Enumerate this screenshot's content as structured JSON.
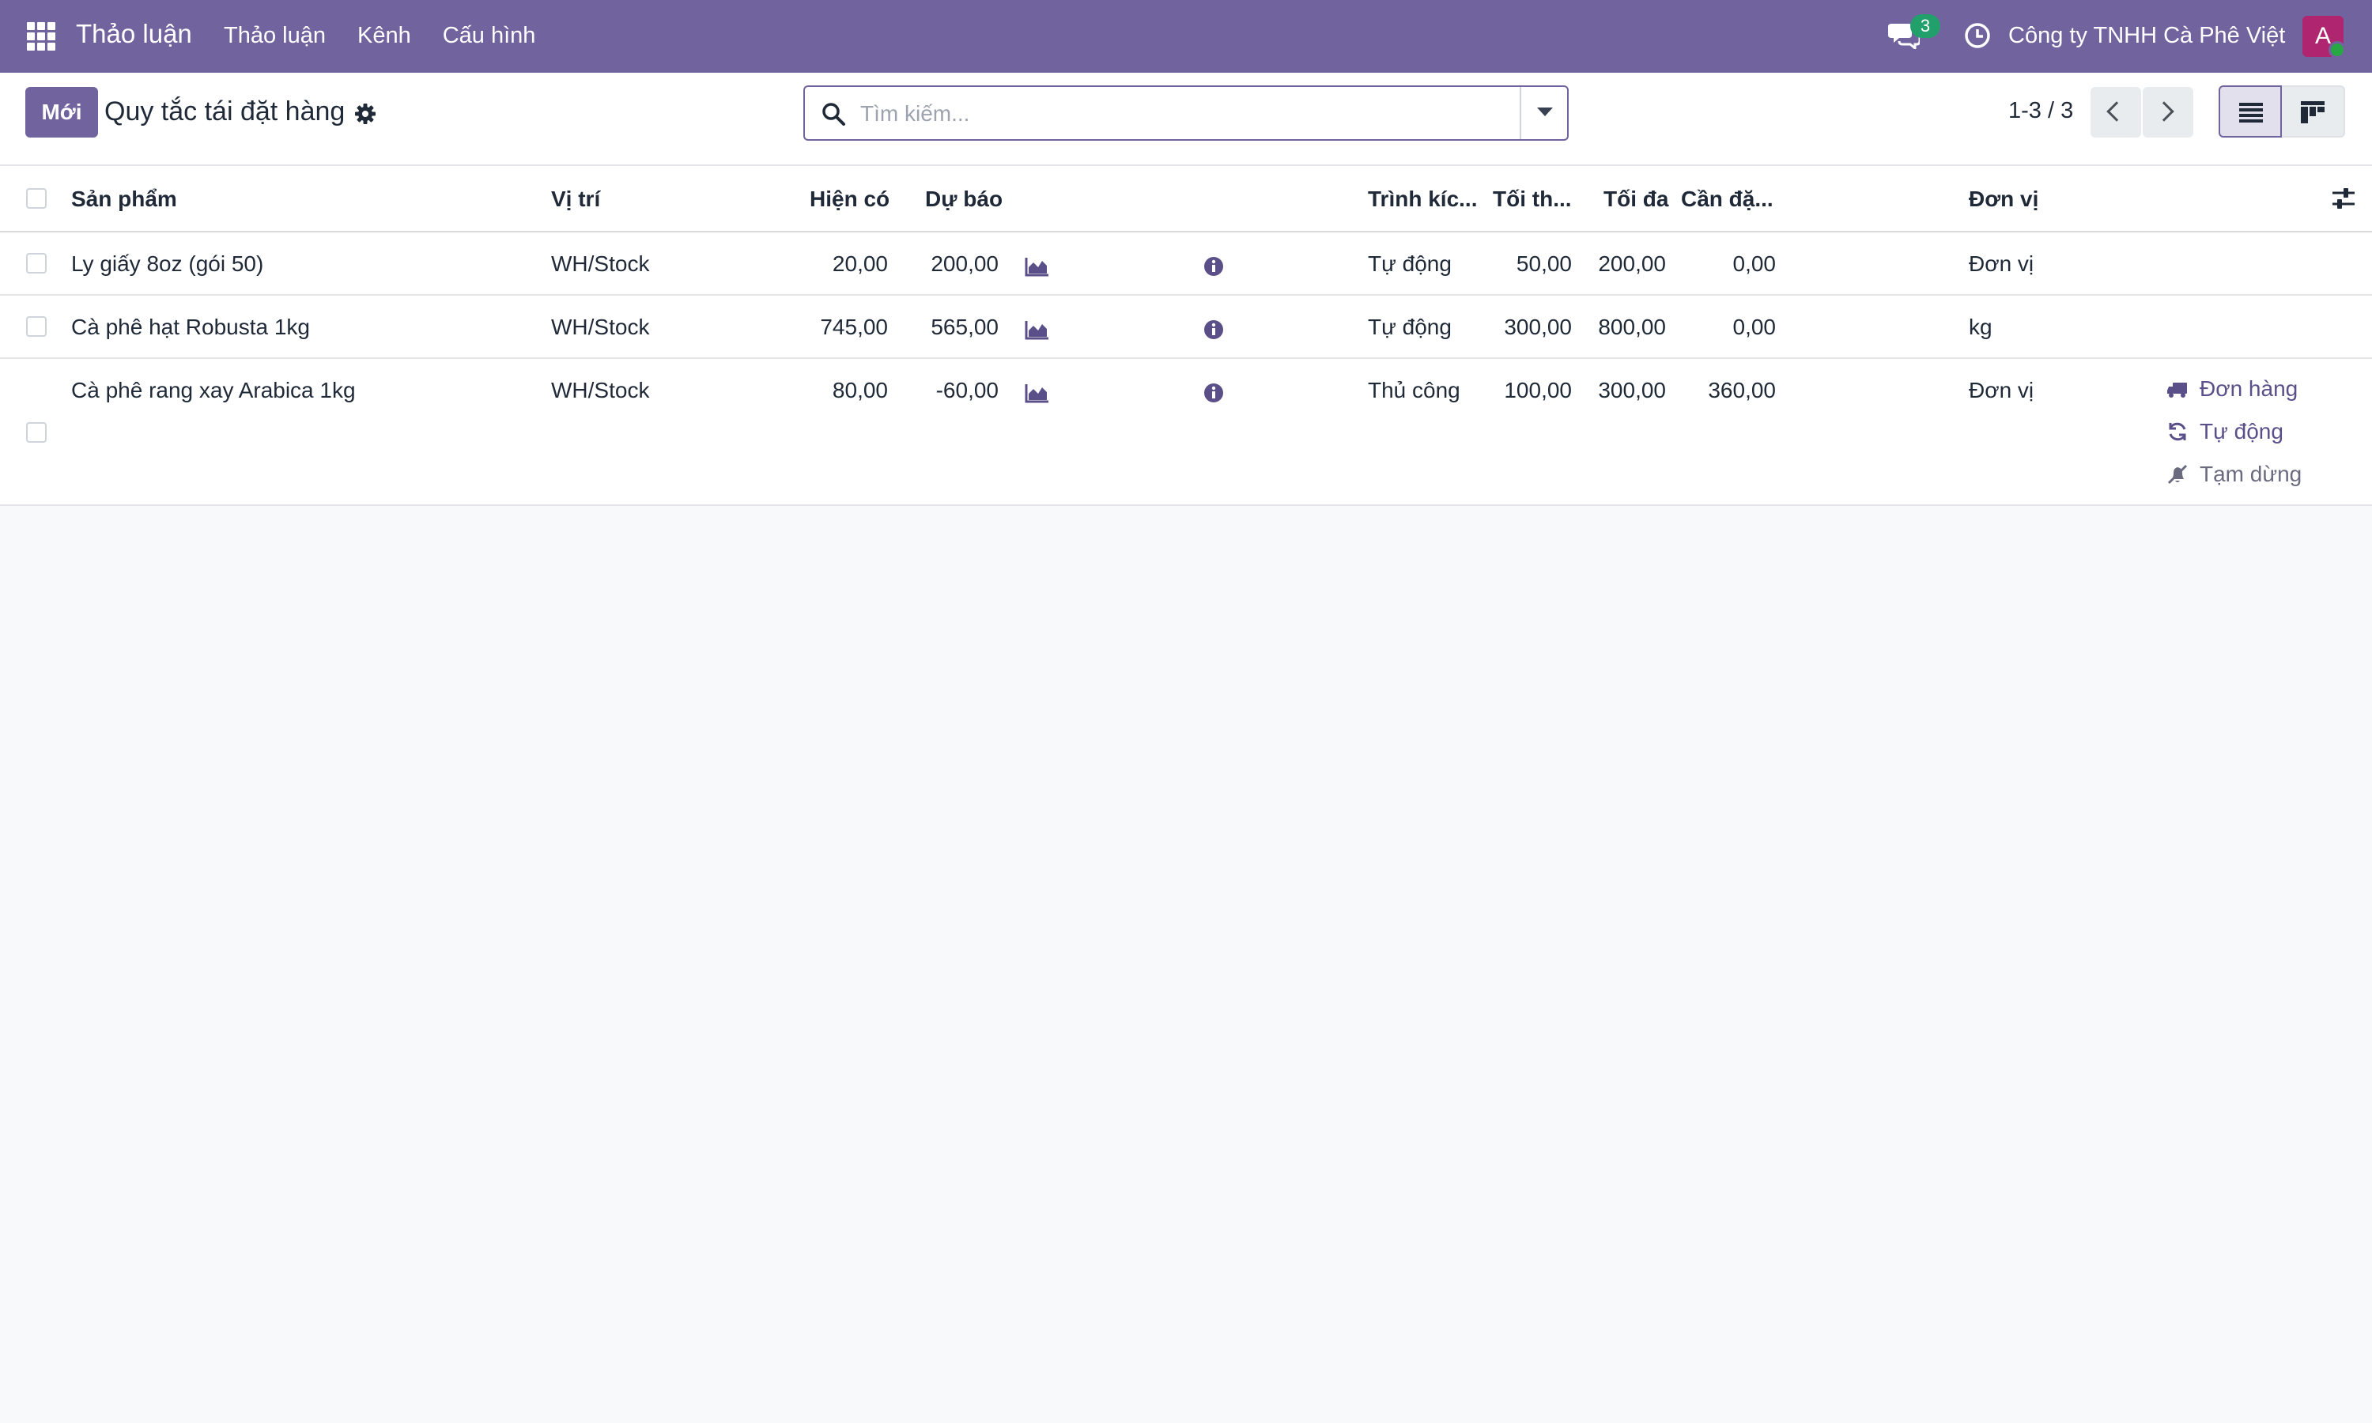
{
  "navbar": {
    "brand": "Thảo luận",
    "menu": [
      "Thảo luận",
      "Kênh",
      "Cấu hình"
    ],
    "chat_badge": "3",
    "company": "Công ty TNHH Cà Phê Việt",
    "avatar_letter": "A"
  },
  "control": {
    "new_label": "Mới",
    "title": "Quy tắc tái đặt hàng",
    "search_placeholder": "Tìm kiếm...",
    "pager": "1-3 / 3"
  },
  "table": {
    "headers": {
      "product": "Sản phẩm",
      "location": "Vị trí",
      "on_hand": "Hiện có",
      "forecast": "Dự báo",
      "trigger": "Trình kíc...",
      "min": "Tối th...",
      "max": "Tối đa",
      "to_order": "Cần đặ...",
      "uom": "Đơn vị"
    },
    "rows": [
      {
        "product": "Ly giấy 8oz (gói 50)",
        "location": "WH/Stock",
        "on_hand": "20,00",
        "forecast": "200,00",
        "trigger": "Tự động",
        "min": "50,00",
        "max": "200,00",
        "to_order": "0,00",
        "uom": "Đơn vị"
      },
      {
        "product": "Cà phê hạt Robusta 1kg",
        "location": "WH/Stock",
        "on_hand": "745,00",
        "forecast": "565,00",
        "trigger": "Tự động",
        "min": "300,00",
        "max": "800,00",
        "to_order": "0,00",
        "uom": "kg"
      },
      {
        "product": "Cà phê rang xay Arabica 1kg",
        "location": "WH/Stock",
        "on_hand": "80,00",
        "forecast": "-60,00",
        "trigger": "Thủ công",
        "min": "100,00",
        "max": "300,00",
        "to_order": "360,00",
        "uom": "Đơn vị",
        "actions": [
          "Đơn hàng",
          "Tự động",
          "Tạm dừng"
        ]
      }
    ]
  }
}
